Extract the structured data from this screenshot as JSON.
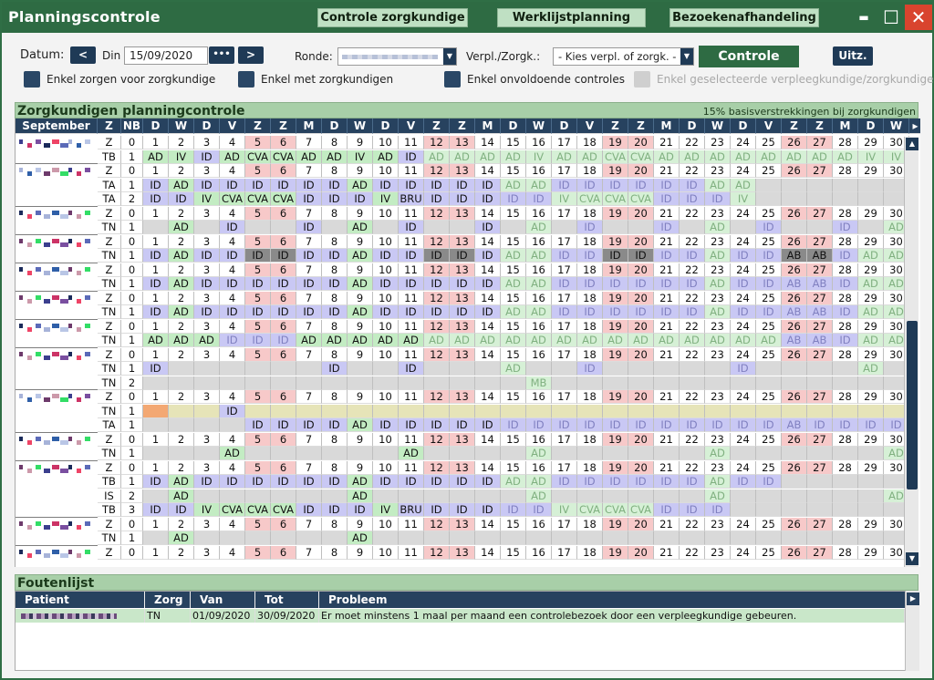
{
  "app": {
    "title": "Planningscontrole",
    "tabs": [
      "Controle zorgkundige",
      "Werklijstplanning",
      "Bezoekenafhandeling"
    ],
    "win": {
      "minimize": "▬",
      "maximize": "☐",
      "close": "✕"
    }
  },
  "toolbar": {
    "datum_label": "Datum:",
    "prev": "<",
    "din_label": "Din",
    "date": "15/09/2020",
    "dots": "•••",
    "next": ">",
    "ronde_label": "Ronde:",
    "verpl_label": "Verpl./Zorgk.:",
    "verpl_value": "- Kies verpl. of zorgk. -",
    "controle": "Controle",
    "uitz": "Uitz."
  },
  "filters": [
    "Enkel zorgen voor zorgkundige",
    "Enkel met zorgkundigen",
    "Enkel onvoldoende controles",
    "Enkel geselecteerde verpleegkundige/zorgkundige"
  ],
  "planning": {
    "title": "Zorgkundigen planningcontrole",
    "note": "15% basisverstrekkingen bij zorgkundigen",
    "header": {
      "month": "September",
      "z": "Z",
      "nb": "NB",
      "days": [
        "D",
        "W",
        "D",
        "V",
        "Z",
        "Z",
        "M",
        "D",
        "W",
        "D",
        "V",
        "Z",
        "Z",
        "M",
        "D",
        "W",
        "D",
        "V",
        "Z",
        "Z",
        "M",
        "D",
        "W",
        "D",
        "V",
        "Z",
        "Z",
        "M",
        "D",
        "W"
      ]
    },
    "weekend_days": [
      5,
      6,
      12,
      13,
      19,
      20,
      26,
      27
    ],
    "rows": [
      {
        "z": "Z",
        "nb": "0",
        "cells": "num",
        "sep": false
      },
      {
        "z": "TB",
        "nb": "1",
        "cells": "AD,IV,ID,AD,CVA,CVA,AD,AD,IV,AD,ID,ad,ad,ad,ad,iv,ad,ad,cva,cva,ad,ad,ad,ad,ad,ad,ad,ad,iv,iv",
        "sep": true
      },
      {
        "z": "Z",
        "nb": "0",
        "cells": "num",
        "sep": false
      },
      {
        "z": "TA",
        "nb": "1",
        "cells": "ID,AD,ID,ID,ID,ID,ID,ID,AD,ID,ID,ID,ID,ID,ad,ad,id,id,id,id,id,id,ad,ad,_,_,_,_,_,_",
        "sep": false
      },
      {
        "z": "TA",
        "nb": "2",
        "cells": "ID,ID,IV,CVA,CVA,CVA,ID,ID,ID,IV,BRU,ID,ID,ID,id,id,iv,cva,cva,cva,id,id,id,iv,_,_,_,_,_,_",
        "sep": true
      },
      {
        "z": "Z",
        "nb": "0",
        "cells": "num",
        "sep": false
      },
      {
        "z": "TN",
        "nb": "1",
        "cells": "_,AD,_,ID,_,_,ID,_,AD,_,ID,_,_,ID,_,ad,_,id,_,_,id,_,ad,_,id,_,_,id,_,ad",
        "sep": true
      },
      {
        "z": "Z",
        "nb": "0",
        "cells": "num",
        "sep": false
      },
      {
        "z": "TN",
        "nb": "1",
        "cells": "ID,AD,ID,ID,XD,XD,ID,ID,AD,ID,ID,XD,XD,ID,ad,ad,id,id,XD,XD,id,id,ad,id,id,XB,XB,id,ad,ad",
        "sep": true
      },
      {
        "z": "Z",
        "nb": "0",
        "cells": "num",
        "sep": false
      },
      {
        "z": "TN",
        "nb": "1",
        "cells": "ID,AD,ID,ID,ID,ID,ID,ID,AD,ID,ID,ID,ID,ID,ad,ad,id,id,id,id,id,id,ad,id,id,ab,ab,id,ad,ad",
        "sep": true
      },
      {
        "z": "Z",
        "nb": "0",
        "cells": "num",
        "sep": false
      },
      {
        "z": "TN",
        "nb": "1",
        "cells": "ID,AD,ID,ID,ID,ID,ID,ID,AD,ID,ID,ID,ID,ID,ad,ad,id,id,id,id,id,id,ad,id,id,ab,ab,id,ad,ad",
        "sep": true
      },
      {
        "z": "Z",
        "nb": "0",
        "cells": "num",
        "sep": false
      },
      {
        "z": "TN",
        "nb": "1",
        "cells": "AD,AD,AD,id,id,id,AD,AD,AD,AD,AD,ad,ad,ad,ad,ad,ad,ad,ad,ad,ad,ad,ad,ad,ad,ab,ab,id,ad,ad",
        "sep": true
      },
      {
        "z": "Z",
        "nb": "0",
        "cells": "num",
        "sep": false
      },
      {
        "z": "TN",
        "nb": "1",
        "cells": "ID,_,_,_,_,_,_,ID,_,_,ID,_,_,_,ad,_,_,id,_,_,_,_,_,id,_,_,_,_,ad,_",
        "sep": false
      },
      {
        "z": "TN",
        "nb": "2",
        "cells": "_,_,_,_,_,_,_,_,_,_,_,_,_,_,_,mb,_,_,_,_,_,_,_,_,_,_,_,_,_,_",
        "sep": true
      },
      {
        "z": "Z",
        "nb": "0",
        "cells": "num",
        "sep": false
      },
      {
        "z": "TN",
        "nb": "1",
        "cells": "ORG,hl,hl,ID,hl,hl,hl,hl,hl,hl,hl,hl,hl,hl,hl,hl,hl,hl,hl,hl,hl,hl,hl,hl,hl,hl,hl,hl,hl,hl",
        "sep": false,
        "highlight": true
      },
      {
        "z": "TA",
        "nb": "1",
        "cells": "_,_,_,_,ID,ID,ID,ID,AD,ID,ID,ID,ID,ID,id,id,id,id,id,id,id,id,id,id,id,ab,id,id,id,id",
        "sep": true
      },
      {
        "z": "Z",
        "nb": "0",
        "cells": "num",
        "sep": false
      },
      {
        "z": "TN",
        "nb": "1",
        "cells": "_,_,_,AD,_,_,_,_,_,_,AD,_,_,_,_,ad,_,_,_,_,_,_,ad,_,_,_,_,_,_,ad",
        "sep": true
      },
      {
        "z": "Z",
        "nb": "0",
        "cells": "num",
        "sep": false
      },
      {
        "z": "TB",
        "nb": "1",
        "cells": "ID,AD,ID,ID,ID,ID,ID,ID,AD,ID,ID,ID,ID,ID,ad,ad,id,id,id,id,id,id,ad,id,id,_,_,_,_,_",
        "sep": false
      },
      {
        "z": "IS",
        "nb": "2",
        "cells": "_,AD,_,_,_,_,_,_,AD,_,_,_,_,_,_,ad,_,_,_,_,_,_,ad,_,_,_,_,_,_,ad",
        "sep": false
      },
      {
        "z": "TB",
        "nb": "3",
        "cells": "ID,ID,IV,CVA,CVA,CVA,ID,ID,ID,IV,BRU,ID,ID,ID,id,id,iv,cva,cva,cva,id,id,id,_,_,_,_,_,_,_",
        "sep": true
      },
      {
        "z": "Z",
        "nb": "0",
        "cells": "num",
        "sep": false
      },
      {
        "z": "TN",
        "nb": "1",
        "cells": "_,AD,_,_,_,_,_,_,AD,_,_,_,_,_,_,_,_,_,_,_,_,_,_,_,_,_,_,_,_,_",
        "sep": true
      },
      {
        "z": "Z",
        "nb": "0",
        "cells": "num",
        "sep": false
      }
    ]
  },
  "foutenlijst": {
    "title": "Foutenlijst",
    "columns": [
      "Patient",
      "Zorg",
      "Van",
      "Tot",
      "Probleem"
    ],
    "rows": [
      {
        "zorg": "TN",
        "van": "01/09/2020",
        "tot": "30/09/2020",
        "probleem": "Er moet minstens 1 maal per maand  een controlebezoek door een verpleegkundige gebeuren."
      }
    ]
  },
  "colors": {
    "title_green": "#2e6b43",
    "section_green": "#a8cfa8",
    "header_navy": "#27425f",
    "weekend": "#f7c9c9",
    "id": "#c9c8f4",
    "ad": "#c3ecc3"
  }
}
